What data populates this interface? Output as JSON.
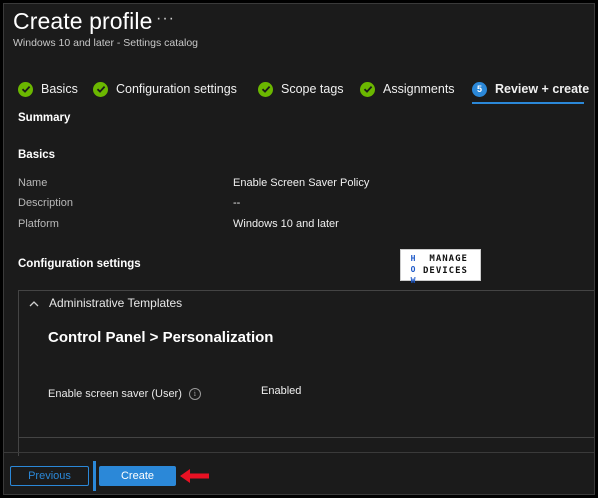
{
  "header": {
    "title": "Create profile",
    "more_label": "···",
    "subtitle": "Windows 10 and later - Settings catalog"
  },
  "wizard": {
    "steps": [
      {
        "label": "Basics",
        "state": "complete"
      },
      {
        "label": "Configuration settings",
        "state": "complete"
      },
      {
        "label": "Scope tags",
        "state": "complete"
      },
      {
        "label": "Assignments",
        "state": "complete"
      },
      {
        "label": "Review + create",
        "state": "active",
        "number": "5"
      }
    ]
  },
  "summary": {
    "heading": "Summary",
    "basics_heading": "Basics",
    "fields": [
      {
        "label": "Name",
        "value": "Enable Screen Saver Policy"
      },
      {
        "label": "Description",
        "value": "--"
      },
      {
        "label": "Platform",
        "value": "Windows 10 and later"
      }
    ],
    "config_heading": "Configuration settings"
  },
  "logo": {
    "how_to": "HOW TO",
    "manage": "MANAGE",
    "devices": "DEVICES"
  },
  "config": {
    "group_label": "Administrative Templates",
    "breadcrumb": "Control Panel > Personalization",
    "setting_label": "Enable screen saver (User)",
    "setting_value": "Enabled",
    "info_glyph": "i"
  },
  "footer": {
    "previous_label": "Previous",
    "create_label": "Create"
  },
  "colors": {
    "accent": "#2b88d8",
    "success": "#6bb700",
    "background": "#1b1b1b",
    "annotation_arrow": "#e81123"
  }
}
